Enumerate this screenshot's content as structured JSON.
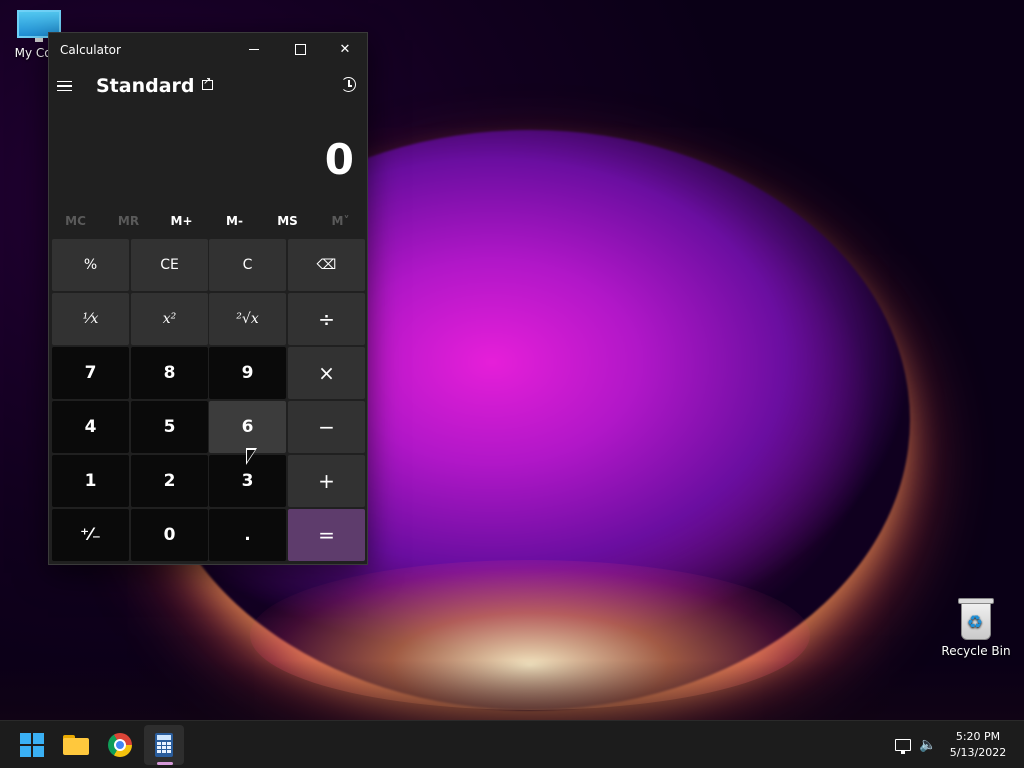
{
  "desktop": {
    "icons": [
      {
        "label": "My Com",
        "icon": "computer-icon"
      },
      {
        "label": "Recycle Bin",
        "icon": "recycle-bin-icon"
      }
    ]
  },
  "calculator": {
    "window_title": "Calculator",
    "mode_title": "Standard",
    "display_value": "0",
    "memory": [
      "MC",
      "MR",
      "M+",
      "M-",
      "MS",
      "M˅"
    ],
    "memory_disabled": [
      "MC",
      "MR",
      "M˅"
    ],
    "keys": [
      "%",
      "CE",
      "C",
      "⌫",
      "¹⁄x",
      "x²",
      "²√x",
      "÷",
      "7",
      "8",
      "9",
      "×",
      "4",
      "5",
      "6",
      "−",
      "1",
      "2",
      "3",
      "+",
      "⁺⁄₋",
      "0",
      ".",
      "="
    ],
    "hovered_key": "6",
    "accent_color": "#5e3c6c"
  },
  "taskbar": {
    "apps": [
      "start-icon",
      "file-explorer-icon",
      "chrome-icon",
      "calculator-icon"
    ],
    "active_app": "calculator-icon",
    "time": "5:20 PM",
    "date": "5/13/2022"
  }
}
